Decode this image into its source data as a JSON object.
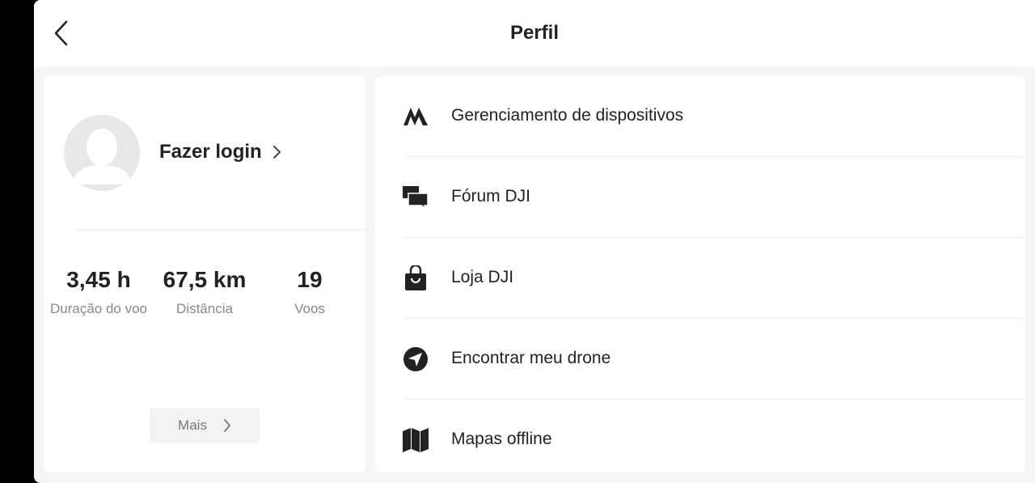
{
  "header": {
    "title": "Perfil",
    "back_icon": "chevron-left-icon"
  },
  "profile": {
    "avatar_icon": "user-placeholder-icon",
    "login_label": "Fazer login",
    "stats": [
      {
        "value": "3,45 h",
        "label": "Duração do voo"
      },
      {
        "value": "67,5 km",
        "label": "Distância"
      },
      {
        "value": "19",
        "label": "Voos"
      }
    ],
    "more_label": "Mais"
  },
  "menu": {
    "items": [
      {
        "label": "Gerenciamento de dispositivos",
        "icon": "device-management-icon"
      },
      {
        "label": "Fórum DJI",
        "icon": "forum-icon"
      },
      {
        "label": "Loja DJI",
        "icon": "shopping-bag-icon"
      },
      {
        "label": "Encontrar meu drone",
        "icon": "find-drone-icon"
      },
      {
        "label": "Mapas offline",
        "icon": "map-icon"
      }
    ]
  }
}
